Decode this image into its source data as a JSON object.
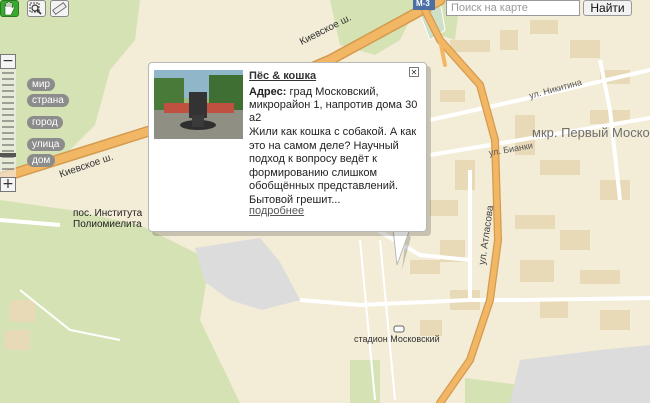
{
  "toolbar": {
    "hand_icon": "hand-pan-icon",
    "zoom_rect_icon": "magnifier-zoom-rect-icon",
    "ruler_icon": "ruler-icon",
    "search_placeholder": "Поиск на карте",
    "find_label": "Найти"
  },
  "zoom": {
    "plus": "+",
    "minus": "−",
    "levels": [
      "мир",
      "страна",
      "город",
      "улица",
      "дом"
    ]
  },
  "map": {
    "colors": {
      "land": "#f3ecd6",
      "green": "#d5e3b4",
      "road_major": "#f2b765",
      "road_minor": "#ffffff",
      "industrial": "#dcdcdc",
      "buildings": "#e8d9b7"
    },
    "labels": {
      "highway_badge": "М-3",
      "road_kievskoe_top": "Киевское ш.",
      "road_kievskoe_left": "Киевское ш.",
      "district": "мкр. Первый Москов",
      "street_nikitina": "ул. Никитина",
      "street_bianki": "ул. Бианки",
      "street_atlasova": "ул. Атласова",
      "settlement_line1": "пос. Института",
      "settlement_line2": "Полиомиелита",
      "stadium": "стадион Московский"
    }
  },
  "balloon": {
    "title": "Пёс & кошка",
    "address_label": "Адрес:",
    "address_value": "град Московский, микрорайон 1, напротив дома 30 а2",
    "description": "Жили как кошка с собакой. А как это на самом деле? Научный подход к вопросу ведёт к формированию слишком обобщённых представлений. Бытовой грешит...",
    "more_link": "подробнее",
    "close_icon": "close-icon",
    "thumbnail": "photo-thumbnail"
  }
}
